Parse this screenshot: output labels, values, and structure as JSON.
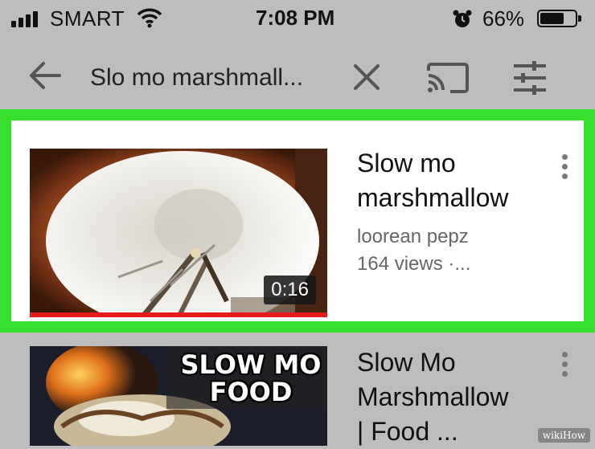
{
  "status_bar": {
    "carrier": "SMART",
    "time": "7:08 PM",
    "battery": "66%",
    "icons": [
      "signal-icon",
      "wifi-icon",
      "alarm-icon",
      "battery-icon"
    ]
  },
  "search_bar": {
    "query": "Slo mo marshmall...",
    "icons": [
      "back-arrow-icon",
      "clear-icon",
      "cast-icon",
      "filter-icon"
    ]
  },
  "results": [
    {
      "title_line1": "Slow mo",
      "title_line2": "marshmallow",
      "channel": "loorean pepz",
      "views": "164 views ·...",
      "duration": "0:16",
      "highlighted": true
    },
    {
      "title_line1": "Slow Mo",
      "title_line2": "Marshmallow",
      "title_line3": "| Food ...",
      "thumbnail_text_line1": "SLOW MO",
      "thumbnail_text_line2": "FOOD",
      "highlighted": false
    }
  ],
  "colors": {
    "highlight": "#38e02e",
    "progress": "#e21b1b",
    "background": "#bdbdbd"
  },
  "watermark": "wikiHow"
}
